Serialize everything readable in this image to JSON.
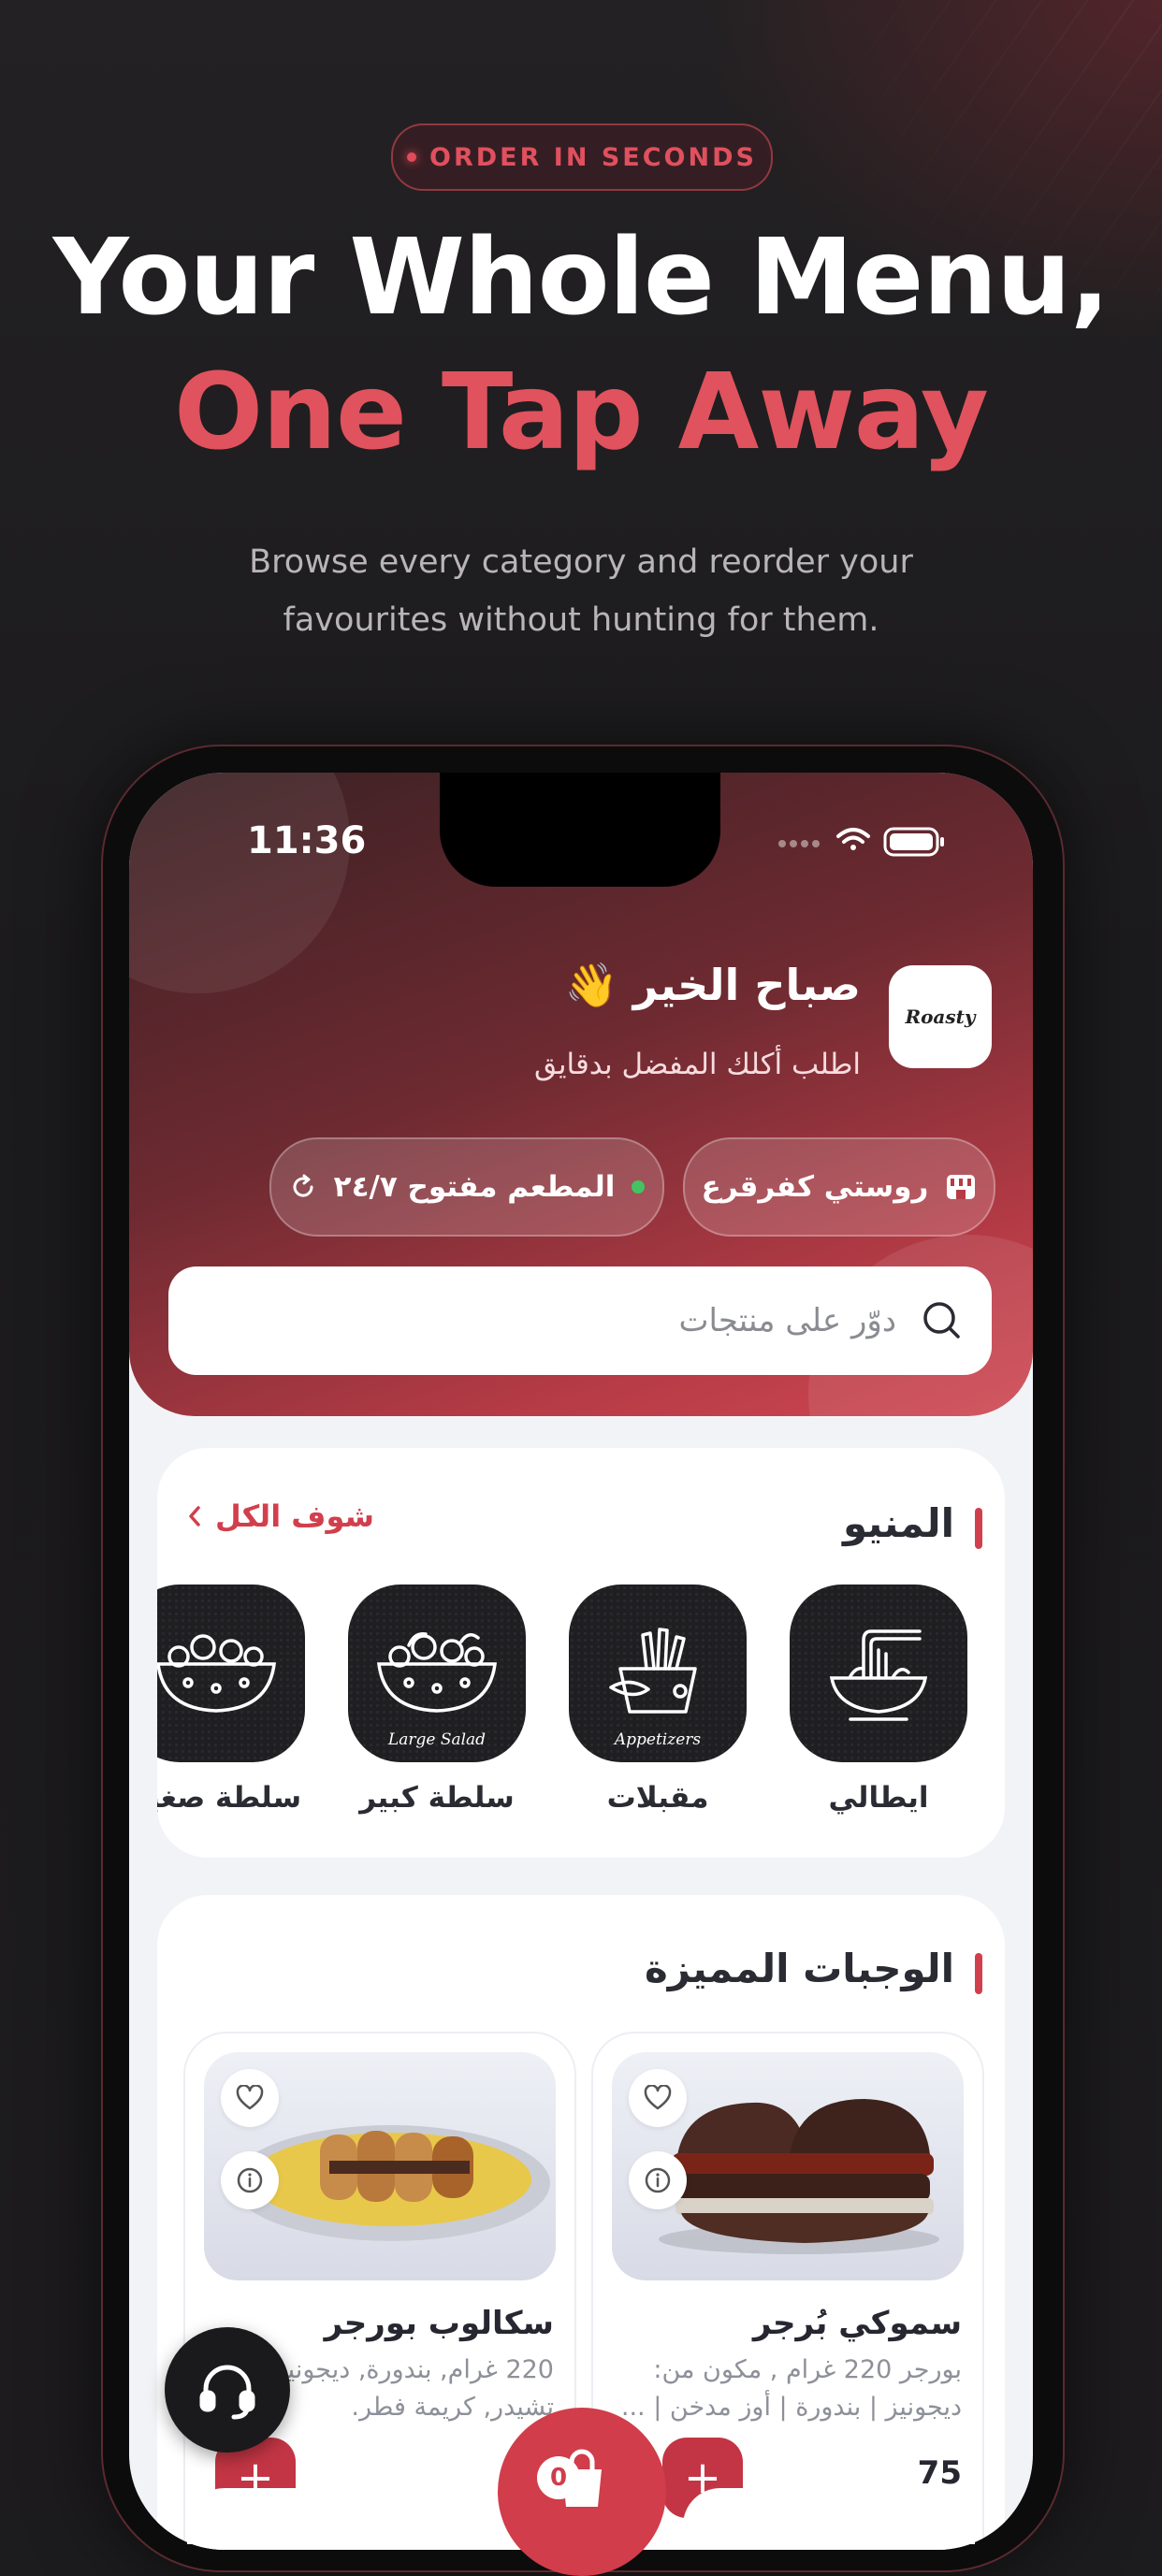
{
  "hero": {
    "badge": "ORDER IN SECONDS",
    "title_line1": "Your Whole Menu,",
    "title_line2": "One Tap Away",
    "subtitle_line1": "Browse every category and reorder your",
    "subtitle_line2": "favourites without hunting for them."
  },
  "status_bar": {
    "time": "11:36"
  },
  "header": {
    "logo_text": "Roasty",
    "greeting": "صباح الخير 👋",
    "greeting_sub": "اطلب أكلك المفضل بدقايق",
    "store_chip": "روستي كفرقرع",
    "open_chip": "المطعم مفتوح ٢٤/٧",
    "search_placeholder": "دوّر على منتجات"
  },
  "menu_section": {
    "title": "المنيو",
    "see_all": "شوف الكل",
    "categories": [
      {
        "label": "ايطالي",
        "icon": "noodles-icon",
        "caption": ""
      },
      {
        "label": "مقبلات",
        "icon": "fries-icon",
        "caption": "Appetizers"
      },
      {
        "label": "سلطة كبير",
        "icon": "salad-bowl-icon",
        "caption": "Large Salad"
      },
      {
        "label": "سلطة صغير",
        "icon": "salad-bowl-icon",
        "caption": ""
      }
    ]
  },
  "featured_section": {
    "title": "الوجبات المميزة",
    "products": [
      {
        "name": "سموكي بُرجر",
        "desc": "بورجر 220 غرام , مكون من: ديجونيز | بندورة | أوز مدخن | ...",
        "price": "75"
      },
      {
        "name": "سكالوب بورجر",
        "desc": "220 غرام, بندورة, ديجونيز, تشيدر, كريمة فطر.",
        "price": ""
      }
    ]
  },
  "cart": {
    "count": "0"
  },
  "colors": {
    "accent": "#d23f4c",
    "background": "#1c1b1d"
  }
}
